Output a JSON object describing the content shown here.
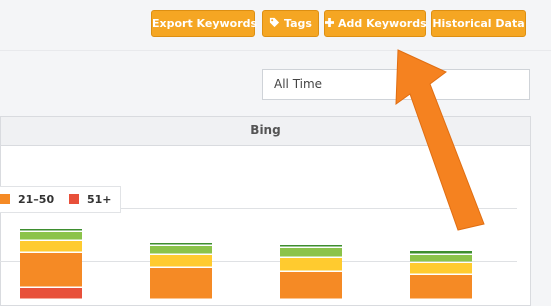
{
  "toolbar": {
    "export_label": "Export Keywords",
    "tags_label": "Tags",
    "tags_icon": "tag-icon",
    "add_label": "Add Keywords",
    "add_icon": "plus-icon",
    "historical_label": "Historical Data"
  },
  "filter": {
    "range_value": "All Time"
  },
  "panel": {
    "title": "Bing"
  },
  "legend": [
    {
      "label": "21–50",
      "color": "#f58a25"
    },
    {
      "label": "51+",
      "color": "#e8503a"
    }
  ],
  "colors": {
    "button": "#f5a623",
    "arrow": "#f58220",
    "dark_green": "#3e8e2f",
    "light_green": "#8bc34a",
    "yellow": "#ffcb2f",
    "orange": "#f58a25",
    "red": "#e8503a"
  },
  "chart_data": {
    "type": "bar",
    "stacked": true,
    "categories": [
      "",
      "",
      "",
      ""
    ],
    "series": [
      {
        "name": "",
        "color": "#3e8e2f",
        "values": [
          3,
          3,
          3,
          4
        ]
      },
      {
        "name": "",
        "color": "#8bc34a",
        "values": [
          9,
          9,
          10,
          8
        ]
      },
      {
        "name": "",
        "color": "#ffcb2f",
        "values": [
          12,
          13,
          14,
          12
        ]
      },
      {
        "name": "21–50",
        "color": "#f58a25",
        "values": [
          35,
          32,
          28,
          25
        ]
      },
      {
        "name": "51+",
        "color": "#e8503a",
        "values": [
          12,
          0,
          0,
          0
        ]
      }
    ],
    "grid": true
  }
}
